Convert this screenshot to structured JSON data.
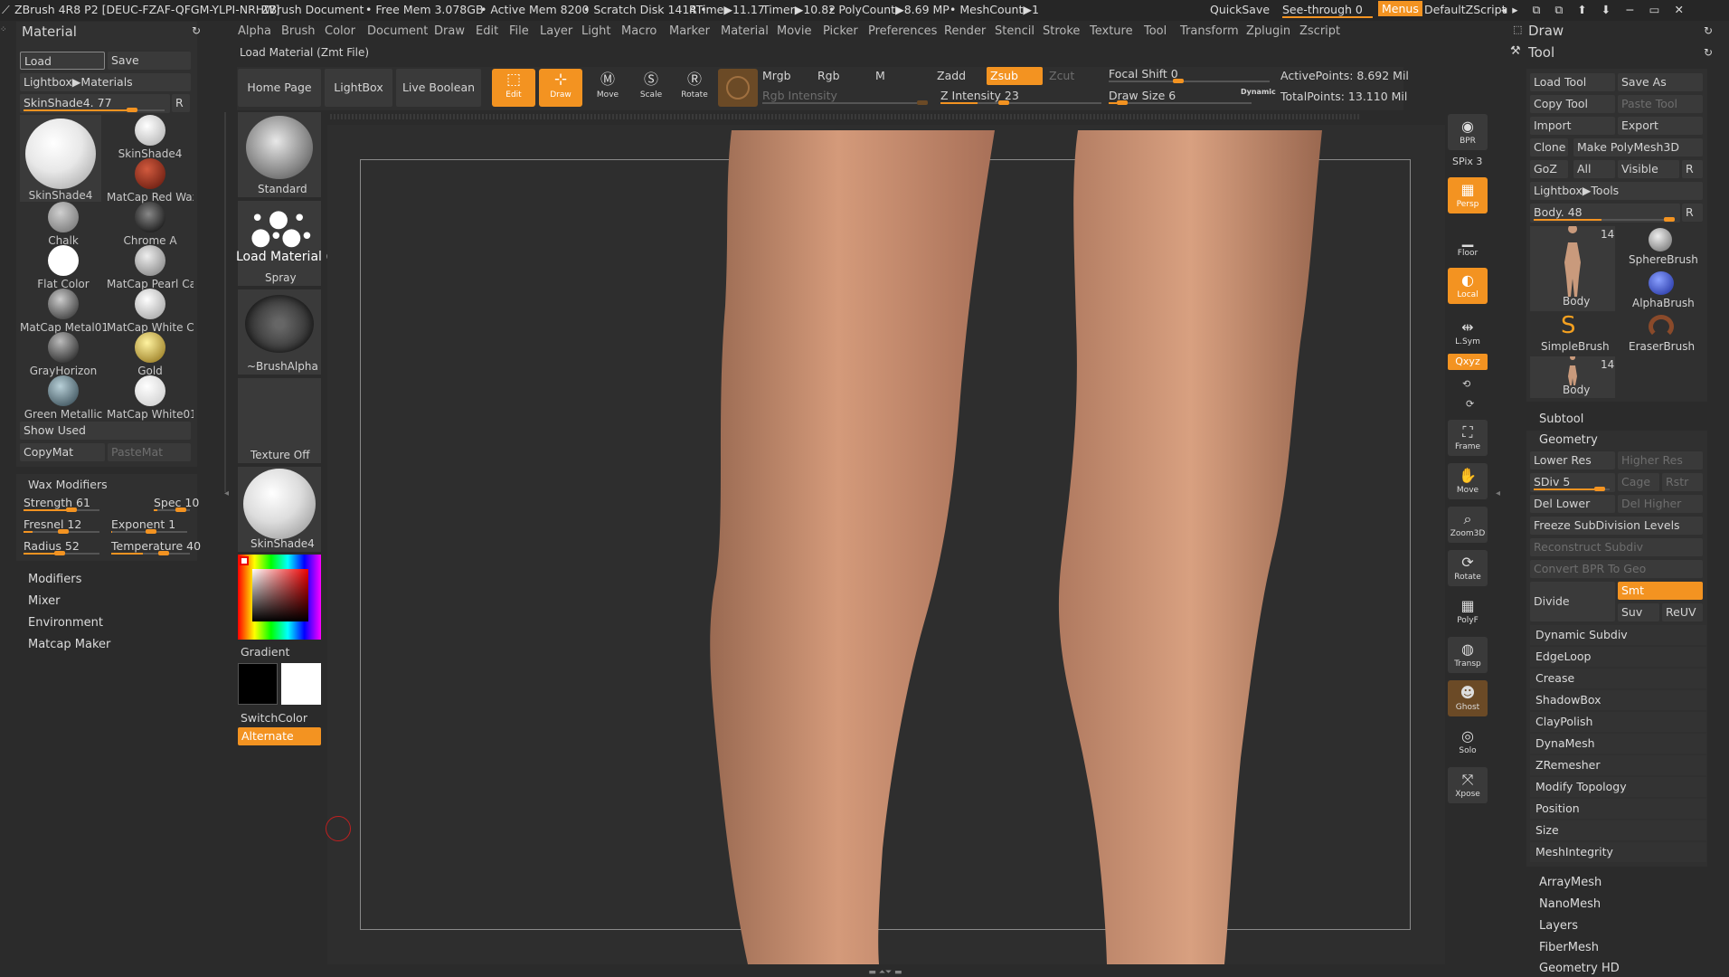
{
  "titlebar": {
    "app": "ZBrush 4R8 P2 [DEUC-FZAF-QFGM-YLPI-NRHW]",
    "doc": "ZBrush Document",
    "free_mem": "• Free Mem 3.078GB",
    "active_mem": "• Active Mem 8200",
    "scratch": "• Scratch Disk 1414 •",
    "rtime": "RTime▶11.17",
    "timer": "Timer▶10.82",
    "polycount": "• PolyCount▶8.69 MP",
    "meshcount": "• MeshCount▶1",
    "quicksave": "QuickSave",
    "seethrough": "See-through  0",
    "menus": "Menus",
    "zscript": "DefaultZScript"
  },
  "menu": [
    "Alpha",
    "Brush",
    "Color",
    "Document",
    "Draw",
    "Edit",
    "File",
    "Layer",
    "Light",
    "Macro",
    "Marker",
    "Material",
    "Movie",
    "Picker",
    "Preferences",
    "Render",
    "Stencil",
    "Stroke",
    "Texture",
    "Tool",
    "Transform",
    "Zplugin",
    "Zscript"
  ],
  "status_label": "Load Material (Zmt File)",
  "tooltip": "Load Material (Zmt File)",
  "left": {
    "title": "Material",
    "load": "Load",
    "save": "Save",
    "lightbox": "Lightbox▶Materials",
    "slider": "SkinShade4. 77",
    "slider_pct": 0.77,
    "r": "R",
    "materials": [
      {
        "name": "SkinShade4",
        "color": "#f5f5f5"
      },
      {
        "name": "SkinShade4",
        "color": "#f2f2f2"
      },
      {
        "name": "MatCap Red Wax",
        "color": "#9a2a18"
      },
      {
        "name": "Chalk",
        "color": "#9a9a9a"
      },
      {
        "name": "Chrome A",
        "color": "#222"
      },
      {
        "name": "Flat Color",
        "color": "#ffffff"
      },
      {
        "name": "MatCap Pearl Ca",
        "color": "#bdbdbd"
      },
      {
        "name": "MatCap Metal01",
        "color": "#6a6a6a"
      },
      {
        "name": "MatCap White Ca",
        "color": "#cfcfcf"
      },
      {
        "name": "GrayHorizon",
        "color": "#555"
      },
      {
        "name": "Gold",
        "color": "#c7a23a"
      },
      {
        "name": "Green Metallic",
        "color": "#5f7f88"
      },
      {
        "name": "MatCap White01",
        "color": "#f0f0f0"
      }
    ],
    "show_used": "Show Used",
    "copymat": "CopyMat",
    "pastemat": "PasteMat",
    "wax_title": "Wax Modifiers",
    "strength": "Strength 61",
    "strength_pct": 0.61,
    "spec": "Spec 10",
    "spec_pct": 0.1,
    "fresnel": "Fresnel 12",
    "fresnel_pct": 0.12,
    "exponent": "Exponent 1",
    "exponent_pct": 0.01,
    "radius": "Radius 52",
    "radius_pct": 0.52,
    "temperature": "Temperature 40",
    "temperature_pct": 0.4,
    "subsections": [
      "Modifiers",
      "Mixer",
      "Environment",
      "Matcap Maker"
    ]
  },
  "brushcol": {
    "brush": "Standard",
    "stroke": "Spray",
    "alpha": "~BrushAlpha",
    "texture": "Texture Off",
    "material": "SkinShade4",
    "gradient": "Gradient",
    "switchcolor": "SwitchColor",
    "alternate": "Alternate"
  },
  "topshelf": {
    "home": "Home Page",
    "lightbox": "LightBox",
    "live_boolean": "Live Boolean",
    "edit": "Edit",
    "draw": "Draw",
    "move": "Move",
    "scale": "Scale",
    "rotate": "Rotate",
    "mrgb": "Mrgb",
    "rgb": "Rgb",
    "m": "M",
    "rgb_intensity": "Rgb Intensity",
    "zadd": "Zadd",
    "zsub": "Zsub",
    "zcut": "Zcut",
    "z_intensity": "Z Intensity 23",
    "z_intensity_pct": 0.23,
    "focal_shift": "Focal Shift 0",
    "focal_shift_pct": 0.5,
    "draw_size": "Draw Size 6",
    "draw_size_pct": 0.06,
    "dynamic": "Dynamic",
    "active_points": "ActivePoints: 8.692 Mil",
    "total_points": "TotalPoints: 13.110 Mil"
  },
  "rightshelf": [
    {
      "g": "◉",
      "t": "BPR",
      "on": false
    },
    {
      "g": "SPix 3",
      "t": "",
      "on": false
    },
    {
      "g": "▦",
      "t": "Persp",
      "on": true
    },
    {
      "g": "▁",
      "t": "Floor",
      "on": false
    },
    {
      "g": "◐",
      "t": "Local",
      "on": true
    },
    {
      "g": "⇹",
      "t": "L.Sym",
      "on": false
    },
    {
      "g": "Qxyz",
      "t": "",
      "on": true
    },
    {
      "g": "⛶",
      "t": "Frame",
      "on": false
    },
    {
      "g": "✋",
      "t": "Move",
      "on": false
    },
    {
      "g": "⌕",
      "t": "Zoom3D",
      "on": false
    },
    {
      "g": "⟳",
      "t": "Rotate",
      "on": false
    },
    {
      "g": "▦",
      "t": "PolyF",
      "on": false
    },
    {
      "g": "◍",
      "t": "Transp",
      "on": false
    },
    {
      "g": "☻",
      "t": "Ghost",
      "on": true
    },
    {
      "g": "◎",
      "t": "Solo",
      "on": false
    },
    {
      "g": "⤧",
      "t": "Xpose",
      "on": false
    }
  ],
  "right": {
    "draw": "Draw",
    "tool": "Tool",
    "load_tool": "Load Tool",
    "save_as": "Save As",
    "copy_tool": "Copy Tool",
    "paste_tool": "Paste Tool",
    "import": "Import",
    "export": "Export",
    "clone": "Clone",
    "make_polymesh": "Make PolyMesh3D",
    "goz": "GoZ",
    "all": "All",
    "visible": "Visible",
    "r": "R",
    "lightbox_tools": "Lightbox▶Tools",
    "body_slider": "Body. 48",
    "body_pct": 0.48,
    "tools": [
      {
        "name": "Body",
        "count": "14"
      },
      {
        "name": "SphereBrush",
        "count": ""
      },
      {
        "name": "AlphaBrush",
        "count": ""
      },
      {
        "name": "SimpleBrush",
        "count": ""
      },
      {
        "name": "EraserBrush",
        "count": ""
      },
      {
        "name": "Body",
        "count": "14"
      }
    ],
    "subtool": "Subtool",
    "geometry": "Geometry",
    "lower_res": "Lower Res",
    "higher_res": "Higher Res",
    "sdiv": "SDiv 5",
    "sdiv_pct": 0.8,
    "cage": "Cage",
    "rstr": "Rstr",
    "del_lower": "Del Lower",
    "del_higher": "Del Higher",
    "freeze": "Freeze SubDivision Levels",
    "reconstruct": "Reconstruct Subdiv",
    "convert_bpr": "Convert BPR To Geo",
    "divide": "Divide",
    "smt": "Smt",
    "suv": "Suv",
    "reuv": "ReUV",
    "geo_items": [
      "Dynamic Subdiv",
      "EdgeLoop",
      "Crease",
      "ShadowBox",
      "ClayPolish",
      "DynaMesh",
      "ZRemesher",
      "Modify Topology",
      "Position",
      "Size",
      "MeshIntegrity"
    ],
    "bottom_items": [
      "ArrayMesh",
      "NanoMesh",
      "Layers",
      "FiberMesh",
      "Geometry HD"
    ]
  }
}
